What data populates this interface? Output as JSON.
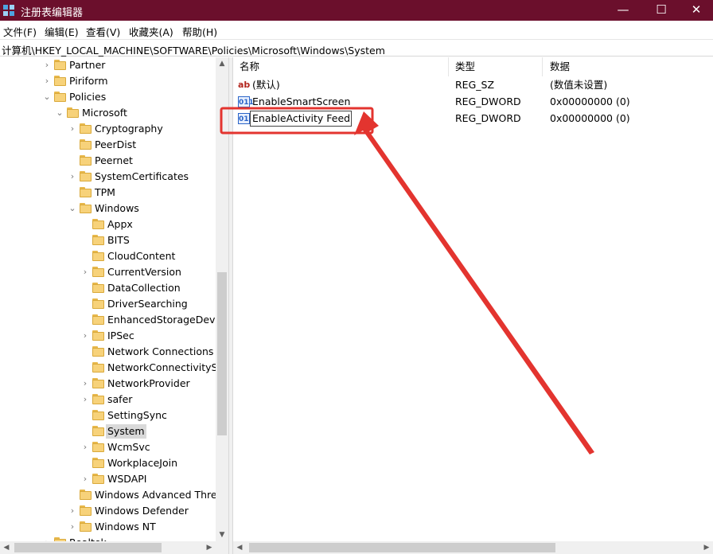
{
  "window": {
    "title": "注册表编辑器",
    "controls": {
      "minimize": "—",
      "maximize": "☐",
      "close": "✕"
    }
  },
  "menu": {
    "items": [
      "文件(F)",
      "编辑(E)",
      "查看(V)",
      "收藏夹(A)",
      "帮助(H)"
    ]
  },
  "address": {
    "path": "计算机\\HKEY_LOCAL_MACHINE\\SOFTWARE\\Policies\\Microsoft\\Windows\\System"
  },
  "tree": {
    "items": [
      {
        "label": "Partner",
        "expander": "›"
      },
      {
        "label": "Piriform",
        "expander": "›"
      },
      {
        "label": "Policies",
        "expander": "⌄"
      },
      {
        "label": "Microsoft",
        "expander": "⌄"
      },
      {
        "label": "Cryptography",
        "expander": "›"
      },
      {
        "label": "PeerDist",
        "expander": ""
      },
      {
        "label": "Peernet",
        "expander": ""
      },
      {
        "label": "SystemCertificates",
        "expander": "›"
      },
      {
        "label": "TPM",
        "expander": ""
      },
      {
        "label": "Windows",
        "expander": "⌄"
      },
      {
        "label": "Appx",
        "expander": ""
      },
      {
        "label": "BITS",
        "expander": ""
      },
      {
        "label": "CloudContent",
        "expander": ""
      },
      {
        "label": "CurrentVersion",
        "expander": "›"
      },
      {
        "label": "DataCollection",
        "expander": ""
      },
      {
        "label": "DriverSearching",
        "expander": ""
      },
      {
        "label": "EnhancedStorageDevice",
        "expander": ""
      },
      {
        "label": "IPSec",
        "expander": "›"
      },
      {
        "label": "Network Connections",
        "expander": ""
      },
      {
        "label": "NetworkConnectivityStatus",
        "expander": ""
      },
      {
        "label": "NetworkProvider",
        "expander": "›"
      },
      {
        "label": "safer",
        "expander": "›"
      },
      {
        "label": "SettingSync",
        "expander": ""
      },
      {
        "label": "System",
        "expander": "",
        "selected": true
      },
      {
        "label": "WcmSvc",
        "expander": "›"
      },
      {
        "label": "WorkplaceJoin",
        "expander": ""
      },
      {
        "label": "WSDAPI",
        "expander": "›"
      },
      {
        "label": "Windows Advanced Threat Protection",
        "expander": ""
      },
      {
        "label": "Windows Defender",
        "expander": "›"
      },
      {
        "label": "Windows NT",
        "expander": "›"
      },
      {
        "label": "Realtek",
        "expander": "›"
      }
    ]
  },
  "list": {
    "headers": {
      "name": "名称",
      "type": "类型",
      "data": "数据"
    },
    "rows": [
      {
        "name": "(默认)",
        "type": "REG_SZ",
        "data": "(数值未设置)",
        "icon": "ab"
      },
      {
        "name": "EnableSmartScreen",
        "type": "REG_DWORD",
        "data": "0x00000000 (0)",
        "icon": "011"
      },
      {
        "name": "EnableActivity Feed",
        "type": "REG_DWORD",
        "data": "0x00000000 (0)",
        "icon": "011",
        "editing": true
      }
    ]
  },
  "scroll": {
    "up": "▲",
    "down": "▼",
    "left": "◀",
    "right": "▶"
  },
  "colors": {
    "titlebar": "#6b0f2c",
    "annotation": "#e3342f",
    "selection": "#d9d9d9",
    "folder": "#f7d27a"
  }
}
